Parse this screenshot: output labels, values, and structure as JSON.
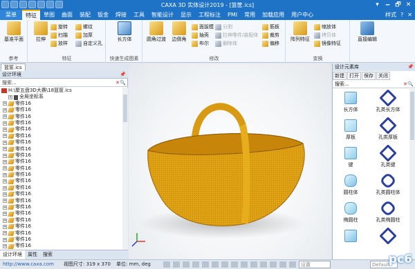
{
  "window": {
    "title": "CAXA 3D 实体设计2019 - [篮筐.ics]",
    "controls": [
      "▾",
      "🗕",
      "🗗",
      "✕"
    ]
  },
  "menu_tabs": [
    "菜单",
    "特征",
    "草图",
    "曲面",
    "装配",
    "钣金",
    "焊接",
    "工具",
    "智能设计",
    "显示",
    "工程标注",
    "PMI",
    "常用",
    "加载应用",
    "用户中心"
  ],
  "menu_right": [
    "样式",
    "?",
    "✕"
  ],
  "ribbon": {
    "groups": {
      "ref": "参考",
      "feature": "特征",
      "quick": "快速生成图素",
      "modify": "修改",
      "transform": "变换"
    },
    "ref_btn": "基准平面",
    "stretch": "拉伸",
    "rotate": "旋转",
    "sweep": "扫描",
    "loft": "放样",
    "thread": "螺纹",
    "thicken": "加厚",
    "custom_hole": "自定义孔",
    "box": "长方体",
    "fillet": "圆角过渡",
    "chamfer": "边倒角",
    "face_draft": "面拔模",
    "shell": "抽壳",
    "boolean": "布尔",
    "split": "分割",
    "stretch_part": "拉伸零件/装配体",
    "remove": "删除体",
    "rib": "筋板",
    "cut": "裁剪",
    "offset": "偏移",
    "array": "阵列特征",
    "scale": "缩放体",
    "copy": "拷贝体",
    "mirror": "镜像特征",
    "direct_edit": "直接编辑"
  },
  "doc_tab": "篮筐.ics",
  "left_panel": {
    "title": "设计环境",
    "search_placeholder": "搜索...",
    "tree": [
      {
        "label": "H:\\聚五盘3D大赛\\18篮筐.ics",
        "type": "root"
      },
      {
        "label": "全局坐标系",
        "type": "axis"
      },
      {
        "label": "零件16"
      },
      {
        "label": "零件16"
      },
      {
        "label": "零件16"
      },
      {
        "label": "零件16"
      },
      {
        "label": "零件16"
      },
      {
        "label": "零件16"
      },
      {
        "label": "零件16"
      },
      {
        "label": "零件16"
      },
      {
        "label": "零件16"
      },
      {
        "label": "零件16"
      },
      {
        "label": "零件16"
      },
      {
        "label": "零件16"
      },
      {
        "label": "零件16"
      },
      {
        "label": "零件16"
      },
      {
        "label": "零件16"
      },
      {
        "label": "零件16"
      },
      {
        "label": "零件16"
      },
      {
        "label": "零件16"
      },
      {
        "label": "零件16"
      },
      {
        "label": "零件16"
      },
      {
        "label": "零件16"
      },
      {
        "label": "零件16"
      },
      {
        "label": "零件16"
      },
      {
        "label": "零件168"
      }
    ],
    "tabs": [
      "设计环境",
      "属性",
      "搜索"
    ]
  },
  "right_panel": {
    "title": "设计元素库",
    "toolbar": [
      "新建",
      "打开",
      "保存",
      "关闭"
    ],
    "search_placeholder": "搜索...",
    "items": [
      {
        "label": "长方体",
        "color": "#7fc3e8"
      },
      {
        "label": "孔类长方体",
        "color": "#2a3f9e"
      },
      {
        "label": "厚板",
        "color": "#9ed6ef"
      },
      {
        "label": "孔类厚板",
        "color": "#2a3f9e"
      },
      {
        "label": "键",
        "color": "#8ccfe9"
      },
      {
        "label": "孔类键",
        "color": "#2a3f9e"
      },
      {
        "label": "圆柱体",
        "color": "#7fc3e8"
      },
      {
        "label": "孔类圆柱体",
        "color": "#2a3f9e"
      },
      {
        "label": "椭圆柱",
        "color": "#8ccfe9"
      },
      {
        "label": "孔类椭圆柱",
        "color": "#2a3f9e"
      },
      {
        "label": "",
        "color": "#7fc3e8"
      },
      {
        "label": "",
        "color": "#2a3f9e"
      }
    ]
  },
  "status": {
    "url": "http://www.caxa.com",
    "view_size": "视图尺寸: 319 x 370",
    "units": "单位: mm, deg",
    "combo1": "设置",
    "combo2": "Default",
    "watermark": "pc6"
  }
}
